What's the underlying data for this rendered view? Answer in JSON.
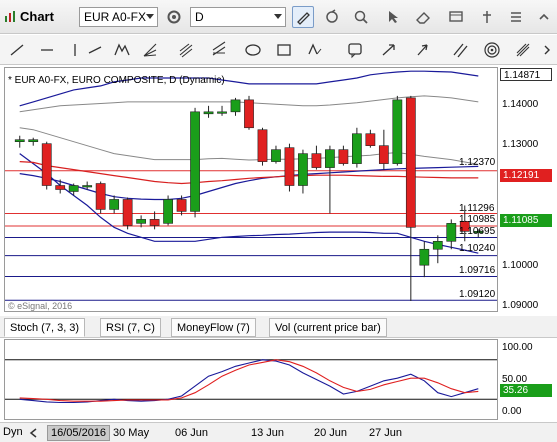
{
  "toolbar": {
    "app_title": "Chart",
    "symbol": "EUR A0-FX",
    "period": "D"
  },
  "chart_header": {
    "study_title": "* EUR A0-FX, EURO COMPOSITE, D (Dynamic)",
    "watermark": "© eSignal, 2016"
  },
  "price_axis": {
    "top_tag": "1.14871",
    "labels": [
      "1.14000",
      "1.13000",
      "1.10000",
      "1.09000"
    ],
    "level_labels": [
      "1.12370",
      "1.11296",
      "1.10985",
      "1.10695",
      "1.10240",
      "1.09716",
      "1.09120"
    ],
    "red_tag": "1.12191",
    "green_tag": "1.11085"
  },
  "study_tabs": [
    {
      "label": "Stoch (7, 3, 3)"
    },
    {
      "label": "RSI (7, C)"
    },
    {
      "label": "MoneyFlow (7)"
    },
    {
      "label": "Vol (current price bar)"
    }
  ],
  "osc_axis": {
    "labels": [
      "100.00",
      "50.00",
      "0.00"
    ],
    "tag": "35.26"
  },
  "statusbar": {
    "mode": "Dyn",
    "date": "16/05/2016",
    "xticks": [
      "30 May",
      "06 Jun",
      "13 Jun",
      "20 Jun",
      "27 Jun"
    ]
  },
  "chart_data": {
    "type": "candlestick",
    "title": "* EUR A0-FX, EURO COMPOSITE, D (Dynamic)",
    "candles": [
      {
        "open": 1.1315,
        "high": 1.1325,
        "low": 1.1295,
        "close": 1.131,
        "dir": "up"
      },
      {
        "open": 1.131,
        "high": 1.132,
        "low": 1.13,
        "close": 1.1315,
        "dir": "up"
      },
      {
        "open": 1.1305,
        "high": 1.131,
        "low": 1.119,
        "close": 1.12,
        "dir": "down"
      },
      {
        "open": 1.12,
        "high": 1.1215,
        "low": 1.118,
        "close": 1.119,
        "dir": "down"
      },
      {
        "open": 1.1185,
        "high": 1.1205,
        "low": 1.1175,
        "close": 1.12,
        "dir": "up"
      },
      {
        "open": 1.12,
        "high": 1.121,
        "low": 1.119,
        "close": 1.12,
        "dir": "up"
      },
      {
        "open": 1.1205,
        "high": 1.121,
        "low": 1.113,
        "close": 1.114,
        "dir": "down"
      },
      {
        "open": 1.114,
        "high": 1.1175,
        "low": 1.113,
        "close": 1.1165,
        "dir": "up"
      },
      {
        "open": 1.1165,
        "high": 1.117,
        "low": 1.109,
        "close": 1.11,
        "dir": "down"
      },
      {
        "open": 1.1105,
        "high": 1.1125,
        "low": 1.1095,
        "close": 1.1115,
        "dir": "up"
      },
      {
        "open": 1.1115,
        "high": 1.1135,
        "low": 1.109,
        "close": 1.11,
        "dir": "down"
      },
      {
        "open": 1.1105,
        "high": 1.1175,
        "low": 1.11,
        "close": 1.1165,
        "dir": "up"
      },
      {
        "open": 1.1165,
        "high": 1.1175,
        "low": 1.1125,
        "close": 1.1135,
        "dir": "down"
      },
      {
        "open": 1.1135,
        "high": 1.1395,
        "low": 1.112,
        "close": 1.1385,
        "dir": "up"
      },
      {
        "open": 1.138,
        "high": 1.14,
        "low": 1.137,
        "close": 1.1385,
        "dir": "up"
      },
      {
        "open": 1.1385,
        "high": 1.14,
        "low": 1.1375,
        "close": 1.1385,
        "dir": "up"
      },
      {
        "open": 1.1385,
        "high": 1.142,
        "low": 1.1375,
        "close": 1.1415,
        "dir": "up"
      },
      {
        "open": 1.1415,
        "high": 1.1425,
        "low": 1.134,
        "close": 1.1345,
        "dir": "down"
      },
      {
        "open": 1.134,
        "high": 1.1345,
        "low": 1.125,
        "close": 1.126,
        "dir": "down"
      },
      {
        "open": 1.126,
        "high": 1.13,
        "low": 1.1255,
        "close": 1.129,
        "dir": "up"
      },
      {
        "open": 1.1295,
        "high": 1.1305,
        "low": 1.1185,
        "close": 1.12,
        "dir": "down"
      },
      {
        "open": 1.12,
        "high": 1.129,
        "low": 1.118,
        "close": 1.128,
        "dir": "up"
      },
      {
        "open": 1.128,
        "high": 1.13,
        "low": 1.124,
        "close": 1.1245,
        "dir": "down"
      },
      {
        "open": 1.1245,
        "high": 1.13,
        "low": 1.113,
        "close": 1.129,
        "dir": "up"
      },
      {
        "open": 1.129,
        "high": 1.13,
        "low": 1.125,
        "close": 1.1255,
        "dir": "down"
      },
      {
        "open": 1.1255,
        "high": 1.1345,
        "low": 1.1245,
        "close": 1.133,
        "dir": "up"
      },
      {
        "open": 1.133,
        "high": 1.134,
        "low": 1.1295,
        "close": 1.13,
        "dir": "down"
      },
      {
        "open": 1.13,
        "high": 1.134,
        "low": 1.124,
        "close": 1.1255,
        "dir": "down"
      },
      {
        "open": 1.1255,
        "high": 1.1425,
        "low": 1.125,
        "close": 1.1415,
        "dir": "up"
      },
      {
        "open": 1.142,
        "high": 1.1425,
        "low": 1.091,
        "close": 1.1095,
        "dir": "down"
      },
      {
        "open": 1.1,
        "high": 1.106,
        "low": 1.097,
        "close": 1.104,
        "dir": "up"
      },
      {
        "open": 1.104,
        "high": 1.1075,
        "low": 1.1005,
        "close": 1.106,
        "dir": "up"
      },
      {
        "open": 1.106,
        "high": 1.1115,
        "low": 1.104,
        "close": 1.1105,
        "dir": "up"
      },
      {
        "open": 1.111,
        "high": 1.115,
        "low": 1.106,
        "close": 1.1085,
        "dir": "down"
      },
      {
        "open": 1.1085,
        "high": 1.109,
        "low": 1.107,
        "close": 1.1085,
        "dir": "up"
      }
    ],
    "bollinger_upper": [
      1.14,
      1.141,
      1.142,
      1.143,
      1.144,
      1.1445,
      1.145,
      1.146,
      1.1465,
      1.147,
      1.147,
      1.147,
      1.147,
      1.147,
      1.147,
      1.1465,
      1.146,
      1.1455,
      1.1455,
      1.1455,
      1.1455,
      1.1455,
      1.1455,
      1.146,
      1.1465,
      1.147,
      1.1478,
      1.1482,
      1.1485,
      1.1487,
      1.1487,
      1.1486,
      1.1485,
      1.148,
      1.1475
    ],
    "bollinger_lower": [
      1.128,
      1.1255,
      1.123,
      1.12,
      1.1175,
      1.115,
      1.112,
      1.1095,
      1.108,
      1.107,
      1.106,
      1.106,
      1.106,
      1.106,
      1.1065,
      1.107,
      1.1072,
      1.1074,
      1.1075,
      1.1077,
      1.1078,
      1.108,
      1.1082,
      1.1083,
      1.1083,
      1.1083,
      1.1082,
      1.108,
      1.108,
      1.107,
      1.106,
      1.1052,
      1.1045,
      1.1038,
      1.103
    ],
    "ma_red": [
      1.126,
      1.1258,
      1.125,
      1.1245,
      1.124,
      1.1235,
      1.123,
      1.1225,
      1.122,
      1.1215,
      1.121,
      1.1207,
      1.1205,
      1.1207,
      1.121,
      1.1212,
      1.1215,
      1.1218,
      1.122,
      1.1222,
      1.1224,
      1.1225,
      1.1226,
      1.1226,
      1.1226,
      1.1225,
      1.1224,
      1.1223,
      1.1223,
      1.1222,
      1.1221,
      1.122,
      1.1219,
      1.1219,
      1.1219
    ],
    "ma_blue": [
      1.123,
      1.1225,
      1.1218,
      1.121,
      1.12,
      1.119,
      1.118,
      1.1172,
      1.1168,
      1.1166,
      1.1165,
      1.1165,
      1.1168,
      1.1175,
      1.1185,
      1.1195,
      1.1205,
      1.1212,
      1.1218,
      1.1222,
      1.1225,
      1.1228,
      1.123,
      1.1232,
      1.1234,
      1.1236,
      1.1238,
      1.124,
      1.1242,
      1.1243,
      1.1244,
      1.1245,
      1.1246,
      1.1247,
      1.1248
    ],
    "bb_mid_gray": [
      1.1345,
      1.134,
      1.133,
      1.132,
      1.131,
      1.13,
      1.129,
      1.128,
      1.1275,
      1.127,
      1.1265,
      1.1265,
      1.1265,
      1.1265,
      1.1267,
      1.1268,
      1.1266,
      1.1264,
      1.1265,
      1.1266,
      1.1266,
      1.1267,
      1.1268,
      1.127,
      1.1272,
      1.1274,
      1.1276,
      1.128,
      1.1283,
      1.1278,
      1.1273,
      1.1269,
      1.1265,
      1.1259,
      1.1253
    ],
    "bb_mid_outer_gray": [
      1.1385,
      1.139,
      1.1395,
      1.14,
      1.1402,
      1.1404,
      1.1406,
      1.1408,
      1.141,
      1.141,
      1.141,
      1.141,
      1.141,
      1.141,
      1.141,
      1.141,
      1.141,
      1.1408,
      1.1406,
      1.1404,
      1.1402,
      1.14,
      1.14,
      1.1402,
      1.1405,
      1.1408,
      1.1412,
      1.1416,
      1.142,
      1.1423,
      1.1425,
      1.1423,
      1.142,
      1.1415,
      1.141
    ],
    "levels": [
      {
        "value": 1.1237,
        "color": "#e03030"
      },
      {
        "value": 1.11296,
        "color": "#e03030"
      },
      {
        "value": 1.10985,
        "color": "#e03030"
      },
      {
        "value": 1.10695,
        "color": "#1a1a8a"
      },
      {
        "value": 1.1024,
        "color": "#1a1a8a"
      },
      {
        "value": 1.09716,
        "color": "#1a1a8a"
      },
      {
        "value": 1.0912,
        "color": "#1a1a8a"
      }
    ],
    "ylim": [
      1.0885,
      1.1495
    ],
    "stoch_k": [
      20,
      18,
      16,
      15,
      15,
      16,
      18,
      20,
      18,
      17,
      18,
      20,
      25,
      40,
      55,
      62,
      70,
      75,
      80,
      78,
      72,
      60,
      50,
      40,
      28,
      32,
      40,
      48,
      52,
      58,
      48,
      30,
      24,
      30,
      36
    ],
    "stoch_d": [
      22,
      21,
      20,
      18,
      17,
      17,
      17,
      18,
      19,
      19,
      19,
      19,
      22,
      30,
      42,
      55,
      64,
      72,
      76,
      80,
      77,
      70,
      60,
      48,
      38,
      32,
      35,
      42,
      47,
      52,
      52,
      45,
      36,
      30,
      32
    ],
    "osc_ylim": [
      -10,
      110
    ],
    "osc_levels": [
      80,
      20
    ],
    "colors": {
      "up": "#1a9e1a",
      "down": "#e02020",
      "upper": "#1a1a9a",
      "red_line": "#d82020",
      "gray": "#888888"
    }
  }
}
